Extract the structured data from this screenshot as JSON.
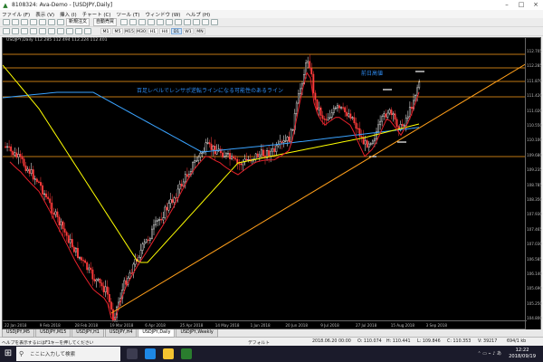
{
  "window": {
    "title": "8108324: Ava-Demo - [USDJPY,Daily]"
  },
  "menu": [
    "ファイル (F)",
    "表示 (V)",
    "挿入 (I)",
    "チャート (C)",
    "ツール (T)",
    "ウィンドウ (W)",
    "ヘルプ (H)"
  ],
  "toolbar": {
    "new_order": "新規注文",
    "auto_trade": "自動売買"
  },
  "timeframes": [
    "M1",
    "M5",
    "M15",
    "M30",
    "H1",
    "H4",
    "D1",
    "W1",
    "MN"
  ],
  "active_timeframe": "D1",
  "chart": {
    "header": "USDJPY,Daily  112.285 112.494 112.224 112.401",
    "annotation_resistance": "前日高値",
    "annotation_support_line": "百足レベルでレンサポ逆転ラインになる可能性のあるライン",
    "colors": {
      "background": "#000000",
      "bull": "#ffffff",
      "bear": "#ff3b3b",
      "ma_fast": "#e8212b",
      "ma_mid": "#ffff00",
      "ma_slow": "#3aa3ff",
      "hline": "#ff9f1a",
      "trendline": "#ff9f1a"
    },
    "price_labels": [
      "112.705",
      "112.285",
      "111.870",
      "111.420",
      "111.020",
      "110.550",
      "110.100",
      "109.680",
      "109.235",
      "108.785",
      "108.350",
      "107.930",
      "107.465",
      "107.030",
      "106.585",
      "106.140",
      "105.690",
      "105.250",
      "104.800"
    ],
    "time_labels": [
      "22 Jan 2018",
      "9 Feb 2018",
      "28 Feb 2018",
      "19 Mar 2018",
      "6 Apr 2018",
      "25 Apr 2018",
      "14 May 2018",
      "1 Jun 2018",
      "20 Jun 2018",
      "9 Jul 2018",
      "27 Jul 2018",
      "15 Aug 2018",
      "3 Sep 2018"
    ]
  },
  "tabs": [
    "USDJPY,M5",
    "USDJPY,M15",
    "USDJPY,H1",
    "USDJPY,H4",
    "USDJPY,Daily",
    "USDJPY,Weekly"
  ],
  "active_tab": "USDJPY,Daily",
  "status": {
    "help": "ヘルプを表示するにはF1キーを押してください",
    "profile": "デフォルト",
    "datetime": "2018.06.20 00:00",
    "o": "O: 110.074",
    "h": "H: 110.441",
    "l": "L: 109.846",
    "c": "C: 110.353",
    "v": "V: 39217",
    "traffic": "694/1 kb"
  },
  "taskbar": {
    "search_placeholder": "ここに入力して検索",
    "time": "12:22",
    "date": "2018/09/19"
  }
}
